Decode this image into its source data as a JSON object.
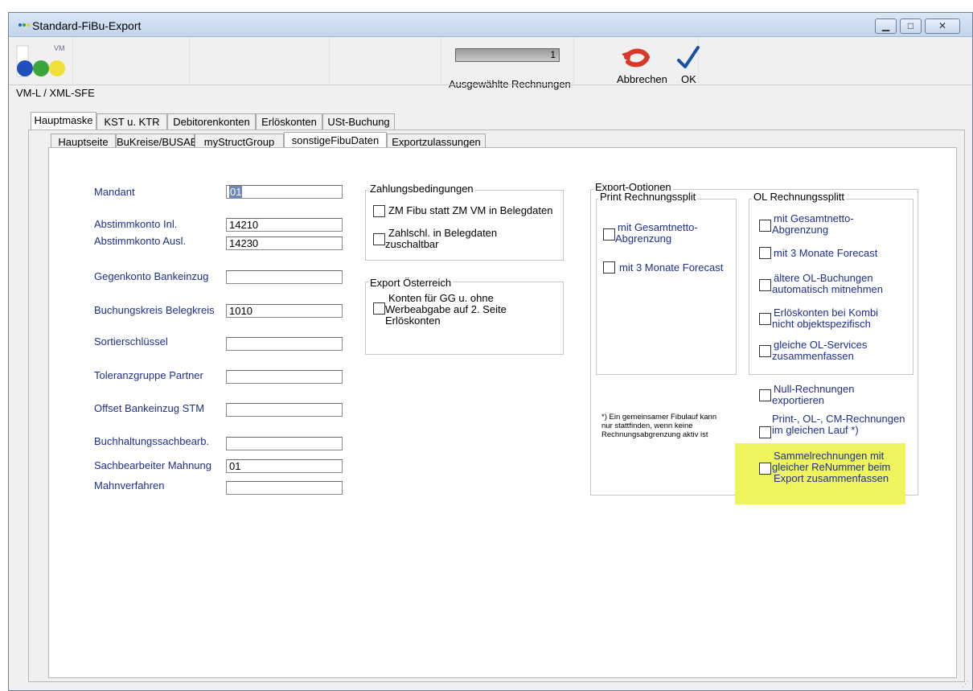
{
  "window": {
    "title": "Standard-FiBu-Export",
    "controls": [
      "minimize",
      "maximize",
      "close"
    ]
  },
  "toolbar": {
    "logo_text": "VM",
    "selected_count": "1",
    "selected_label": "Ausgewählte Rechnungen",
    "cancel_label": "Abbrechen",
    "ok_label": "OK"
  },
  "breadcrumb": "VM-L / XML-SFE",
  "main_tabs": [
    "Hauptmaske",
    "KST u. KTR",
    "Debitorenkonten",
    "Erlöskonten",
    "USt-Buchung"
  ],
  "sub_tabs": [
    "Hauptseite",
    "BuKreise/BUSAB",
    "myStructGroup",
    "sonstigeFibuDaten",
    "Exportzulassungen"
  ],
  "form": {
    "mandant_label": "Mandant",
    "mandant_value": "01",
    "abstimm_inl_label": "Abstimmkonto Inl.",
    "abstimm_inl_value": "14210",
    "abstimm_ausl_label": "Abstimmkonto Ausl.",
    "abstimm_ausl_value": "14230",
    "gegenkonto_label": "Gegenkonto Bankeinzug",
    "gegenkonto_value": "",
    "buchungskreis_label": "Buchungskreis  Belegkreis",
    "buchungskreis_value": "1010",
    "sortier_label": "Sortierschlüssel",
    "sortier_value": "",
    "toleranz_label": "Toleranzgruppe Partner",
    "toleranz_value": "",
    "offset_label": "Offset Bankeinzug STM",
    "offset_value": "",
    "buchhaltung_label": "Buchhaltungssachbearb.",
    "buchhaltung_value": "",
    "sachbearbeiter_label": "Sachbearbeiter Mahnung",
    "sachbearbeiter_value": "01",
    "mahnverfahren_label": "Mahnverfahren",
    "mahnverfahren_value": ""
  },
  "zahlung": {
    "title": "Zahlungsbedingungen",
    "cb1": "ZM Fibu statt ZM VM in Belegdaten",
    "cb2_line1": "Zahlschl. in Belegdaten",
    "cb2_line2": "zuschaltbar"
  },
  "oesterreich": {
    "title": "Export Österreich",
    "cb_line1": "Konten für GG u. ohne",
    "cb_line2": "Werbeabgabe auf 2. Seite",
    "cb_line3": "Erlöskonten"
  },
  "export_optionen": {
    "title": "Export-Optionen",
    "print_title": "Print Rechnungssplit",
    "print_cb1_line1": "mit Gesamtnetto-",
    "print_cb1_line2": "Abgrenzung",
    "print_cb2": "mit 3 Monate Forecast",
    "ol_title": "OL Rechnungssplitt",
    "ol_cb1_line1": "mit Gesamtnetto-",
    "ol_cb1_line2": "Abgrenzung",
    "ol_cb2": "mit 3 Monate Forecast",
    "ol_cb3_line1": "ältere OL-Buchungen",
    "ol_cb3_line2": "automatisch mitnehmen",
    "ol_cb4_line1": "Erlöskonten bei Kombi",
    "ol_cb4_line2": "nicht objektspezifisch",
    "ol_cb5_line1": "gleiche OL-Services",
    "ol_cb5_line2": "zusammenfassen",
    "null_line1": "Null-Rechnungen",
    "null_line2": "exportieren",
    "print_ol_line1": "Print-, OL-, CM-Rechnungen",
    "print_ol_line2": "im gleichen Lauf *)",
    "sammel_line1": "Sammelrechnungen mit",
    "sammel_line2": "gleicher ReNummer beim",
    "sammel_line3": "Export zusammenfassen",
    "note_line1": "*) Ein gemeinsamer Fibulauf kann",
    "note_line2": "nur stattfinden, wenn keine",
    "note_line3": "Rechnungsabgrenzung aktiv ist"
  },
  "colors": {
    "label_blue": "#1f2f8f",
    "highlight": "#eef55c",
    "cancel_red": "#d83a2a",
    "ok_blue": "#1a4fa8"
  }
}
